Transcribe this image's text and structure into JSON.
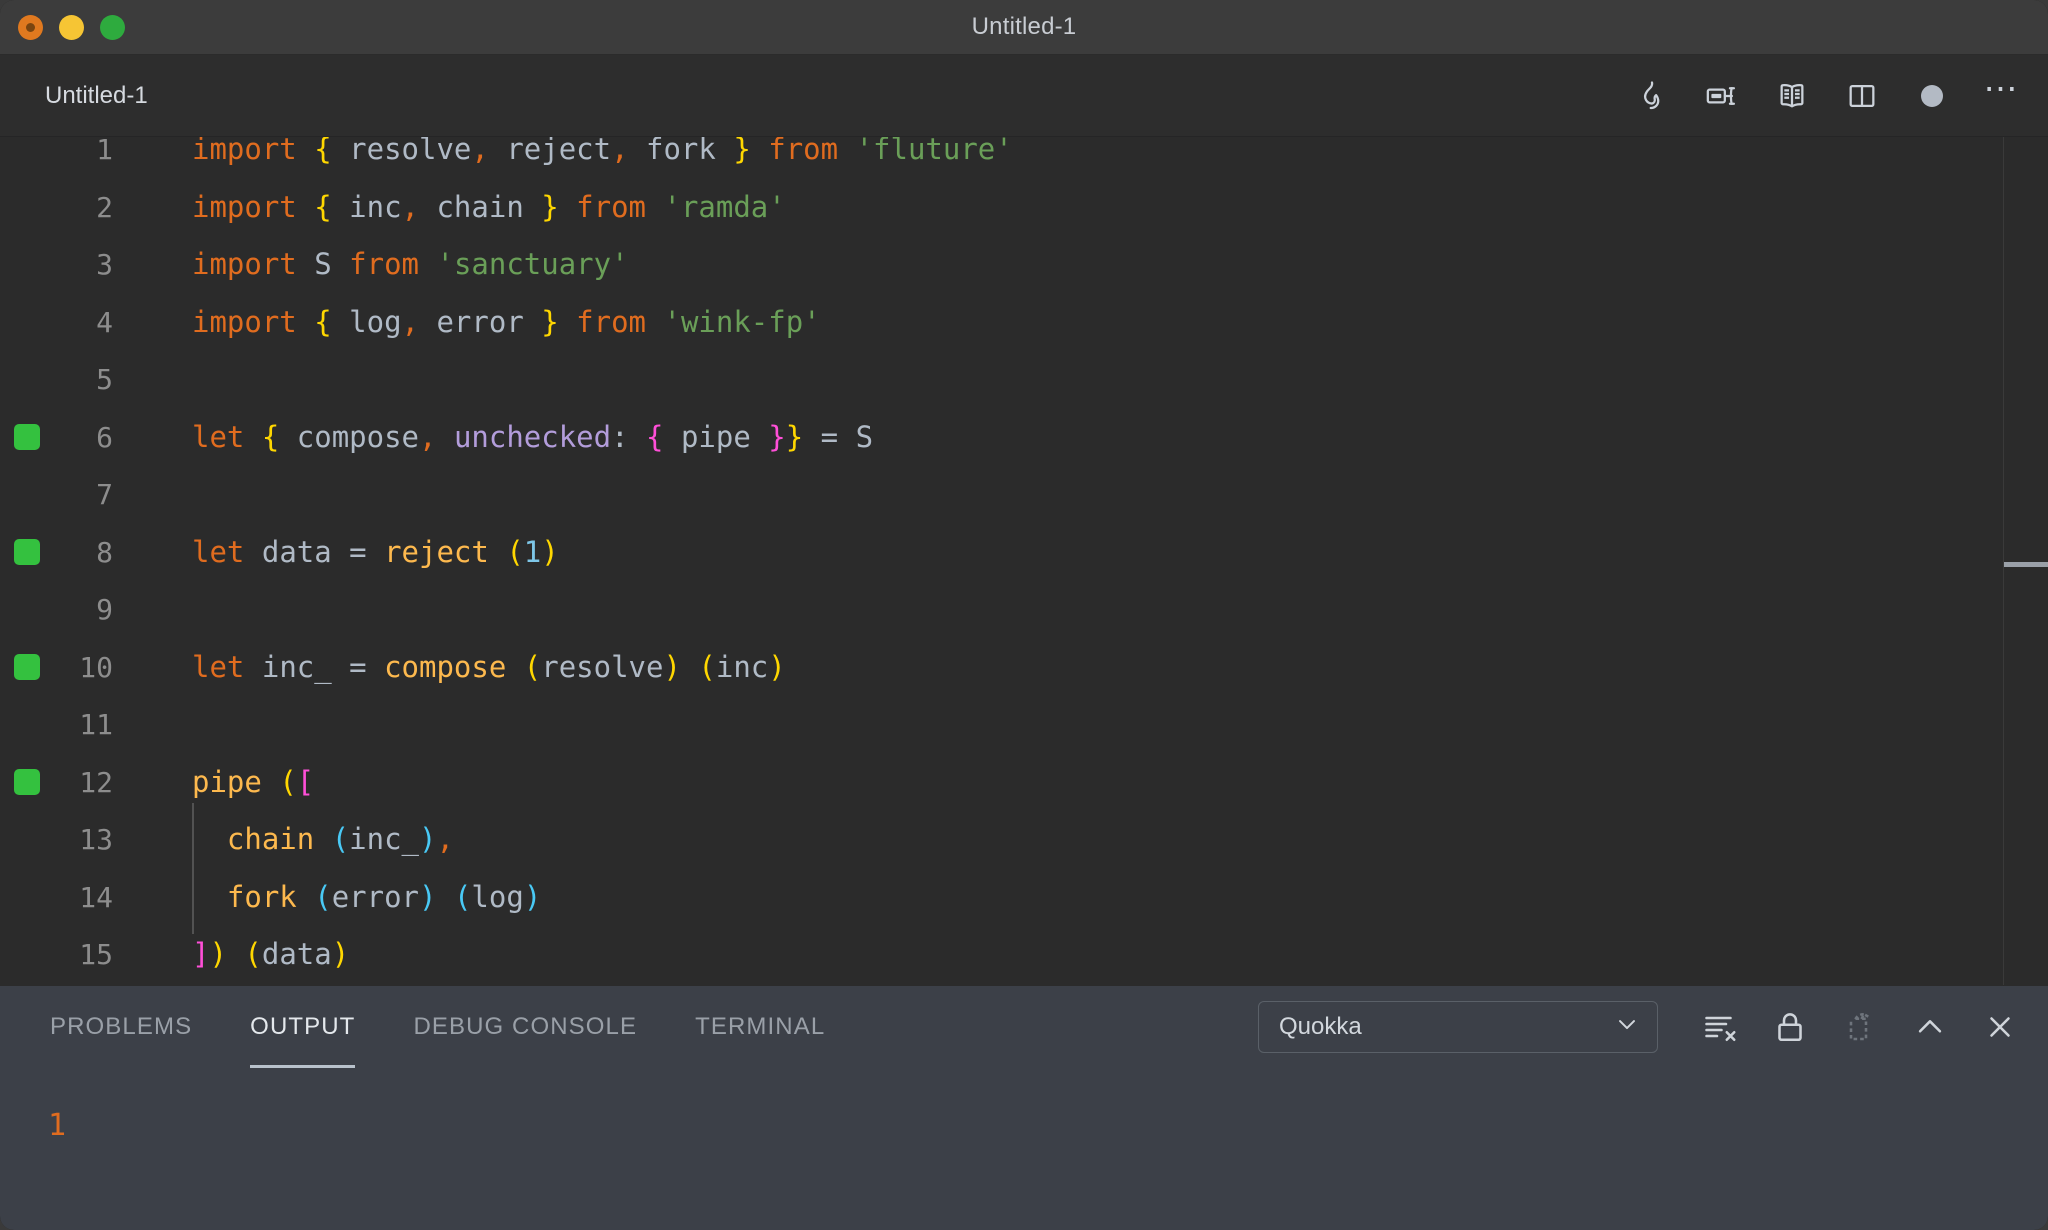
{
  "window": {
    "title": "Untitled-1",
    "traffic_lights": [
      "close-button",
      "minimize-button",
      "maximize-button"
    ]
  },
  "tabbar": {
    "tabs": [
      {
        "label": "Untitled-1",
        "active": true
      }
    ],
    "actions": [
      {
        "name": "quokka-flame-icon",
        "tooltip": "Quokka"
      },
      {
        "name": "run-compare-icon",
        "tooltip": "Run"
      },
      {
        "name": "open-preview-icon",
        "tooltip": "Open Preview"
      },
      {
        "name": "split-editor-icon",
        "tooltip": "Split Editor"
      },
      {
        "name": "unsaved-dot-icon",
        "tooltip": "Unsaved changes"
      },
      {
        "name": "more-actions-icon",
        "tooltip": "More Actions...",
        "glyph": "⋯"
      }
    ]
  },
  "editor": {
    "language": "javascript",
    "lines": [
      {
        "no": "1",
        "marker": false,
        "indent_guide": false,
        "tokens": [
          {
            "t": "import",
            "c": "t-kw"
          },
          {
            "t": " ",
            "c": "t-id"
          },
          {
            "t": "{",
            "c": "b-y"
          },
          {
            "t": " resolve",
            "c": "t-id"
          },
          {
            "t": ",",
            "c": "t-kw"
          },
          {
            "t": " reject",
            "c": "t-id"
          },
          {
            "t": ",",
            "c": "t-kw"
          },
          {
            "t": " fork ",
            "c": "t-id"
          },
          {
            "t": "}",
            "c": "b-y"
          },
          {
            "t": " ",
            "c": "t-id"
          },
          {
            "t": "from",
            "c": "t-kw"
          },
          {
            "t": " ",
            "c": "t-id"
          },
          {
            "t": "'fluture'",
            "c": "t-str"
          }
        ]
      },
      {
        "no": "2",
        "marker": false,
        "indent_guide": false,
        "tokens": [
          {
            "t": "import",
            "c": "t-kw"
          },
          {
            "t": " ",
            "c": "t-id"
          },
          {
            "t": "{",
            "c": "b-y"
          },
          {
            "t": " inc",
            "c": "t-id"
          },
          {
            "t": ",",
            "c": "t-kw"
          },
          {
            "t": " chain ",
            "c": "t-id"
          },
          {
            "t": "}",
            "c": "b-y"
          },
          {
            "t": " ",
            "c": "t-id"
          },
          {
            "t": "from",
            "c": "t-kw"
          },
          {
            "t": " ",
            "c": "t-id"
          },
          {
            "t": "'ramda'",
            "c": "t-str"
          }
        ]
      },
      {
        "no": "3",
        "marker": false,
        "indent_guide": false,
        "tokens": [
          {
            "t": "import",
            "c": "t-kw"
          },
          {
            "t": " ",
            "c": "t-id"
          },
          {
            "t": "S",
            "c": "t-id"
          },
          {
            "t": " ",
            "c": "t-id"
          },
          {
            "t": "from",
            "c": "t-kw"
          },
          {
            "t": " ",
            "c": "t-id"
          },
          {
            "t": "'sanctuary'",
            "c": "t-str"
          }
        ]
      },
      {
        "no": "4",
        "marker": false,
        "indent_guide": false,
        "tokens": [
          {
            "t": "import",
            "c": "t-kw"
          },
          {
            "t": " ",
            "c": "t-id"
          },
          {
            "t": "{",
            "c": "b-y"
          },
          {
            "t": " log",
            "c": "t-id"
          },
          {
            "t": ",",
            "c": "t-kw"
          },
          {
            "t": " error ",
            "c": "t-id"
          },
          {
            "t": "}",
            "c": "b-y"
          },
          {
            "t": " ",
            "c": "t-id"
          },
          {
            "t": "from",
            "c": "t-kw"
          },
          {
            "t": " ",
            "c": "t-id"
          },
          {
            "t": "'wink-fp'",
            "c": "t-str"
          }
        ]
      },
      {
        "no": "5",
        "marker": false,
        "indent_guide": false,
        "tokens": []
      },
      {
        "no": "6",
        "marker": true,
        "indent_guide": false,
        "tokens": [
          {
            "t": "let",
            "c": "t-kw"
          },
          {
            "t": " ",
            "c": "t-id"
          },
          {
            "t": "{",
            "c": "b-y"
          },
          {
            "t": " compose",
            "c": "t-id"
          },
          {
            "t": ",",
            "c": "t-kw"
          },
          {
            "t": " ",
            "c": "t-id"
          },
          {
            "t": "unchecked",
            "c": "t-prop"
          },
          {
            "t": ":",
            "c": "t-id"
          },
          {
            "t": " ",
            "c": "t-id"
          },
          {
            "t": "{",
            "c": "b-m"
          },
          {
            "t": " pipe ",
            "c": "t-id"
          },
          {
            "t": "}",
            "c": "b-m"
          },
          {
            "t": "}",
            "c": "b-y"
          },
          {
            "t": " = ",
            "c": "t-op"
          },
          {
            "t": "S",
            "c": "t-id"
          }
        ]
      },
      {
        "no": "7",
        "marker": false,
        "indent_guide": false,
        "tokens": []
      },
      {
        "no": "8",
        "marker": true,
        "indent_guide": false,
        "tokens": [
          {
            "t": "let",
            "c": "t-kw"
          },
          {
            "t": " ",
            "c": "t-id"
          },
          {
            "t": "data",
            "c": "t-id"
          },
          {
            "t": " = ",
            "c": "t-op"
          },
          {
            "t": "reject",
            "c": "t-fn"
          },
          {
            "t": " ",
            "c": "t-id"
          },
          {
            "t": "(",
            "c": "b-y"
          },
          {
            "t": "1",
            "c": "t-num"
          },
          {
            "t": ")",
            "c": "b-y"
          }
        ]
      },
      {
        "no": "9",
        "marker": false,
        "indent_guide": false,
        "tokens": []
      },
      {
        "no": "10",
        "marker": true,
        "indent_guide": false,
        "tokens": [
          {
            "t": "let",
            "c": "t-kw"
          },
          {
            "t": " ",
            "c": "t-id"
          },
          {
            "t": "inc_",
            "c": "t-id"
          },
          {
            "t": " = ",
            "c": "t-op"
          },
          {
            "t": "compose",
            "c": "t-fn"
          },
          {
            "t": " ",
            "c": "t-id"
          },
          {
            "t": "(",
            "c": "b-y"
          },
          {
            "t": "resolve",
            "c": "t-id"
          },
          {
            "t": ")",
            "c": "b-y"
          },
          {
            "t": " ",
            "c": "t-id"
          },
          {
            "t": "(",
            "c": "b-y"
          },
          {
            "t": "inc",
            "c": "t-id"
          },
          {
            "t": ")",
            "c": "b-y"
          }
        ]
      },
      {
        "no": "11",
        "marker": false,
        "indent_guide": false,
        "tokens": []
      },
      {
        "no": "12",
        "marker": true,
        "indent_guide": false,
        "tokens": [
          {
            "t": "pipe",
            "c": "t-fn"
          },
          {
            "t": " ",
            "c": "t-id"
          },
          {
            "t": "(",
            "c": "b-y"
          },
          {
            "t": "[",
            "c": "b-m"
          }
        ]
      },
      {
        "no": "13",
        "marker": false,
        "indent_guide": true,
        "tokens": [
          {
            "t": "  ",
            "c": "t-id"
          },
          {
            "t": "chain",
            "c": "t-fn"
          },
          {
            "t": " ",
            "c": "t-id"
          },
          {
            "t": "(",
            "c": "b-c"
          },
          {
            "t": "inc_",
            "c": "t-id"
          },
          {
            "t": ")",
            "c": "b-c"
          },
          {
            "t": ",",
            "c": "t-kw"
          }
        ]
      },
      {
        "no": "14",
        "marker": false,
        "indent_guide": true,
        "tokens": [
          {
            "t": "  ",
            "c": "t-id"
          },
          {
            "t": "fork",
            "c": "t-fn"
          },
          {
            "t": " ",
            "c": "t-id"
          },
          {
            "t": "(",
            "c": "b-c"
          },
          {
            "t": "error",
            "c": "t-id"
          },
          {
            "t": ")",
            "c": "b-c"
          },
          {
            "t": " ",
            "c": "t-id"
          },
          {
            "t": "(",
            "c": "b-c"
          },
          {
            "t": "log",
            "c": "t-id"
          },
          {
            "t": ")",
            "c": "b-c"
          }
        ]
      },
      {
        "no": "15",
        "marker": false,
        "indent_guide": false,
        "tokens": [
          {
            "t": "]",
            "c": "b-m"
          },
          {
            "t": ")",
            "c": "b-y"
          },
          {
            "t": " ",
            "c": "t-id"
          },
          {
            "t": "(",
            "c": "b-y"
          },
          {
            "t": "data",
            "c": "t-id"
          },
          {
            "t": ")",
            "c": "b-y"
          }
        ]
      }
    ]
  },
  "panel": {
    "tabs": [
      {
        "label": "PROBLEMS",
        "active": false
      },
      {
        "label": "OUTPUT",
        "active": true
      },
      {
        "label": "DEBUG CONSOLE",
        "active": false
      },
      {
        "label": "TERMINAL",
        "active": false
      }
    ],
    "channel_select": {
      "value": "Quokka",
      "options": [
        "Quokka"
      ]
    },
    "actions": [
      {
        "name": "clear-output-icon",
        "tooltip": "Clear Output"
      },
      {
        "name": "lock-scroll-icon",
        "tooltip": "Turn Auto Scrolling Off"
      },
      {
        "name": "open-in-editor-icon",
        "tooltip": "Open Output in Editor",
        "disabled": true
      },
      {
        "name": "maximize-panel-icon",
        "tooltip": "Maximize Panel Size"
      },
      {
        "name": "close-panel-icon",
        "tooltip": "Close Panel"
      }
    ],
    "output_lines": [
      "1"
    ]
  },
  "colors": {
    "titlebar_bg": "#3c3c3c",
    "tabbar_bg": "#2d2d2d",
    "editor_bg": "#2b2b2b",
    "panel_bg": "#3c4048",
    "keyword": "#e06c1f",
    "string": "#6a9f58",
    "function": "#fdb94e",
    "identifier": "#b0bac6",
    "number": "#7ec7e8",
    "property": "#b39ddb",
    "bracket_level1": "#ffd700",
    "bracket_level2": "#ff4fd8",
    "bracket_level3": "#49c9f5",
    "quokka_marker": "#34c13f",
    "output_text": "#e06c1f"
  }
}
